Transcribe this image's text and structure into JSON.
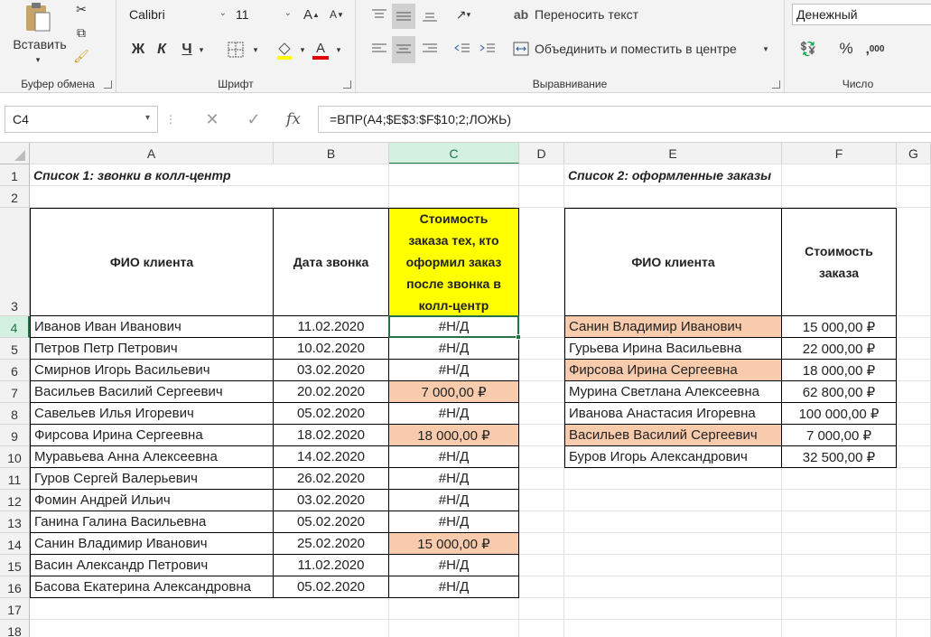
{
  "ribbon": {
    "clipboard": {
      "paste_label": "Вставить",
      "title": "Буфер обмена"
    },
    "font": {
      "name": "Calibri",
      "size": "11",
      "bold": "Ж",
      "italic": "К",
      "underline": "Ч",
      "title": "Шрифт"
    },
    "alignment": {
      "wrap_label": "Переносить текст",
      "merge_label": "Объединить и поместить в центре",
      "title": "Выравнивание"
    },
    "number": {
      "format": "Денежный",
      "percent": "%",
      "title": "Число"
    }
  },
  "formula_bar": {
    "name_box": "C4",
    "cancel": "✕",
    "enter": "✓",
    "fx": "fx",
    "formula": "=ВПР(A4;$E$3:$F$10;2;ЛОЖЬ)"
  },
  "columns": [
    "A",
    "B",
    "C",
    "D",
    "E",
    "F",
    "G"
  ],
  "rows": [
    "1",
    "2",
    "3",
    "4",
    "5",
    "6",
    "7",
    "8",
    "9",
    "10",
    "11",
    "12",
    "13",
    "14",
    "15",
    "16",
    "17",
    "18"
  ],
  "sheet": {
    "title1": "Список 1: звонки в колл-центр",
    "title2": "Список 2: оформленные заказы",
    "h_a": "ФИО клиента",
    "h_b": "Дата звонка",
    "h_c": [
      "Стоимость",
      "заказа тех, кто",
      "оформил заказ",
      "после звонка в",
      "колл-центр"
    ],
    "h_e": "ФИО клиента",
    "h_f": [
      "Стоимость",
      "заказа"
    ],
    "list1": [
      {
        "name": "Иванов Иван Иванович",
        "date": "11.02.2020",
        "value": "#Н/Д",
        "hl": false
      },
      {
        "name": "Петров Петр Петрович",
        "date": "10.02.2020",
        "value": "#Н/Д",
        "hl": false
      },
      {
        "name": "Смирнов Игорь Васильевич",
        "date": "03.02.2020",
        "value": "#Н/Д",
        "hl": false
      },
      {
        "name": "Васильев Василий Сергеевич",
        "date": "20.02.2020",
        "value": "7 000,00 ₽",
        "hl": true
      },
      {
        "name": "Савельев Илья Игоревич",
        "date": "05.02.2020",
        "value": "#Н/Д",
        "hl": false
      },
      {
        "name": "Фирсова Ирина Сергеевна",
        "date": "18.02.2020",
        "value": "18 000,00 ₽",
        "hl": true
      },
      {
        "name": "Муравьева Анна Алексеевна",
        "date": "14.02.2020",
        "value": "#Н/Д",
        "hl": false
      },
      {
        "name": "Гуров Сергей Валерьевич",
        "date": "26.02.2020",
        "value": "#Н/Д",
        "hl": false
      },
      {
        "name": "Фомин Андрей Ильич",
        "date": "03.02.2020",
        "value": "#Н/Д",
        "hl": false
      },
      {
        "name": "Ганина Галина Васильевна",
        "date": "05.02.2020",
        "value": "#Н/Д",
        "hl": false
      },
      {
        "name": "Санин Владимир Иванович",
        "date": "25.02.2020",
        "value": "15 000,00 ₽",
        "hl": true
      },
      {
        "name": "Васин Александр Петрович",
        "date": "11.02.2020",
        "value": "#Н/Д",
        "hl": false
      },
      {
        "name": "Басова Екатерина Александровна",
        "date": "05.02.2020",
        "value": "#Н/Д",
        "hl": false
      }
    ],
    "list2": [
      {
        "name": "Санин Владимир Иванович",
        "value": "15 000,00 ₽",
        "hl": true
      },
      {
        "name": "Гурьева Ирина Васильевна",
        "value": "22 000,00 ₽",
        "hl": false
      },
      {
        "name": "Фирсова Ирина Сергеевна",
        "value": "18 000,00 ₽",
        "hl": true
      },
      {
        "name": "Мурина Светлана Алексеевна",
        "value": "62 800,00 ₽",
        "hl": false
      },
      {
        "name": "Иванова Анастасия Игоревна",
        "value": "100 000,00 ₽",
        "hl": false
      },
      {
        "name": "Васильев Василий Сергеевич",
        "value": "7 000,00 ₽",
        "hl": true
      },
      {
        "name": "Буров Игорь Александрович",
        "value": "32 500,00 ₽",
        "hl": false
      }
    ]
  },
  "colors": {
    "highlight": "#f8cbad",
    "header_yellow": "#ffff00",
    "select_green": "#217346"
  }
}
